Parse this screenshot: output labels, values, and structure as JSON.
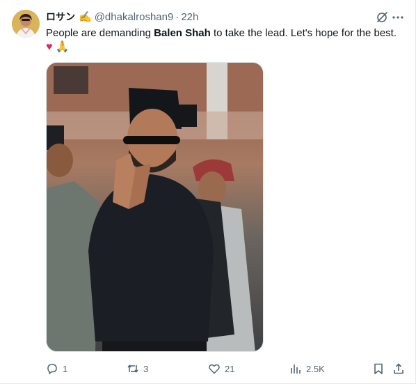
{
  "post": {
    "author_name": "ロサン",
    "author_emoji": "✍️",
    "handle": "@dhakalroshan9",
    "separator": "·",
    "time": "22h",
    "text_before": "People are demanding ",
    "text_bold": "Balen Shah",
    "text_after": " to take the lead. Let's hope for the best.",
    "emoji_heart": "♥",
    "emoji_pray": "🙏"
  },
  "actions": {
    "reply_count": "1",
    "repost_count": "3",
    "like_count": "21",
    "views_count": "2.5K"
  },
  "icons": {
    "avatar": "avatar-photo",
    "grok": "grok-icon",
    "more": "more-icon",
    "reply": "reply-icon",
    "repost": "repost-icon",
    "like": "like-icon",
    "views": "views-icon",
    "bookmark": "bookmark-icon",
    "share": "share-icon"
  },
  "colors": {
    "text": "#0f1419",
    "secondary": "#536471",
    "heart": "#e0245e"
  }
}
